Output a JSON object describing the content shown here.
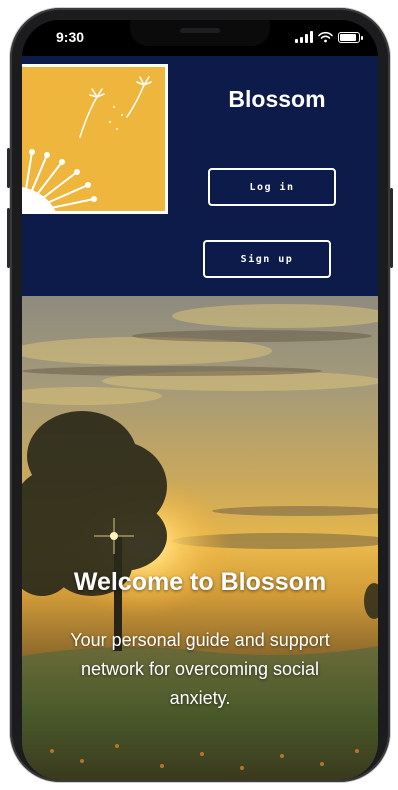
{
  "status_bar": {
    "time": "9:30",
    "battery_level": 0.8
  },
  "header": {
    "app_name": "Blossom",
    "login_label": "Log in",
    "signup_label": "Sign up",
    "background_color": "#0d1b4a",
    "logo_color": "#efb63d"
  },
  "hero": {
    "title": "Welcome to Blossom",
    "subtitle": "Your personal guide and support network for overcoming social anxiety."
  }
}
